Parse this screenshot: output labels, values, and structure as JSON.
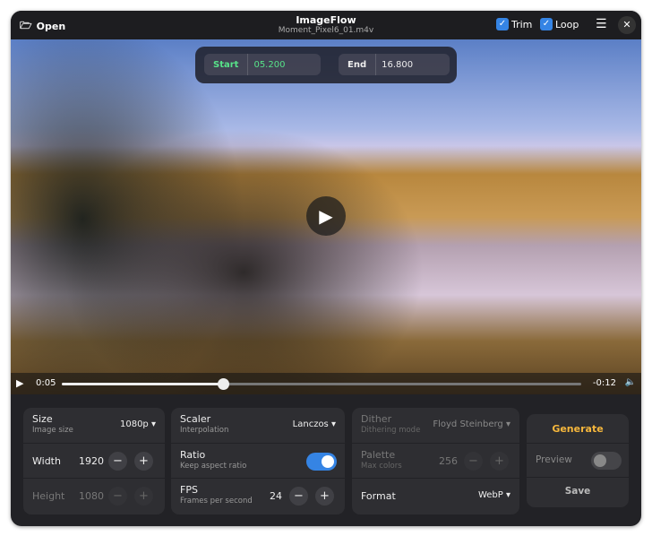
{
  "header": {
    "open_label": "Open",
    "title": "ImageFlow",
    "filename": "Moment_Pixel6_01.m4v",
    "trim_label": "Trim",
    "trim_checked": true,
    "loop_label": "Loop",
    "loop_checked": true
  },
  "trim": {
    "start_label": "Start",
    "start_value": "05.200",
    "end_label": "End",
    "end_value": "16.800"
  },
  "player": {
    "elapsed": "0:05",
    "remaining": "-0:12",
    "progress": 0.31
  },
  "size_card": {
    "size_label": "Size",
    "size_desc": "Image size",
    "size_value": "1080p",
    "width_label": "Width",
    "width_value": "1920",
    "height_label": "Height",
    "height_value": "1080"
  },
  "scaler_card": {
    "scaler_label": "Scaler",
    "scaler_desc": "Interpolation",
    "scaler_value": "Lanczos",
    "ratio_label": "Ratio",
    "ratio_desc": "Keep aspect ratio",
    "ratio_on": true,
    "fps_label": "FPS",
    "fps_desc": "Frames per second",
    "fps_value": "24"
  },
  "dither_card": {
    "dither_label": "Dither",
    "dither_desc": "Dithering mode",
    "dither_value": "Floyd Steinberg",
    "palette_label": "Palette",
    "palette_desc": "Max colors",
    "palette_value": "256",
    "format_label": "Format",
    "format_value": "WebP"
  },
  "actions": {
    "generate_label": "Generate",
    "preview_label": "Preview",
    "preview_on": false,
    "save_label": "Save"
  },
  "colors": {
    "accent": "#3584e4",
    "generate": "#f6b73c",
    "start": "#57e389"
  }
}
